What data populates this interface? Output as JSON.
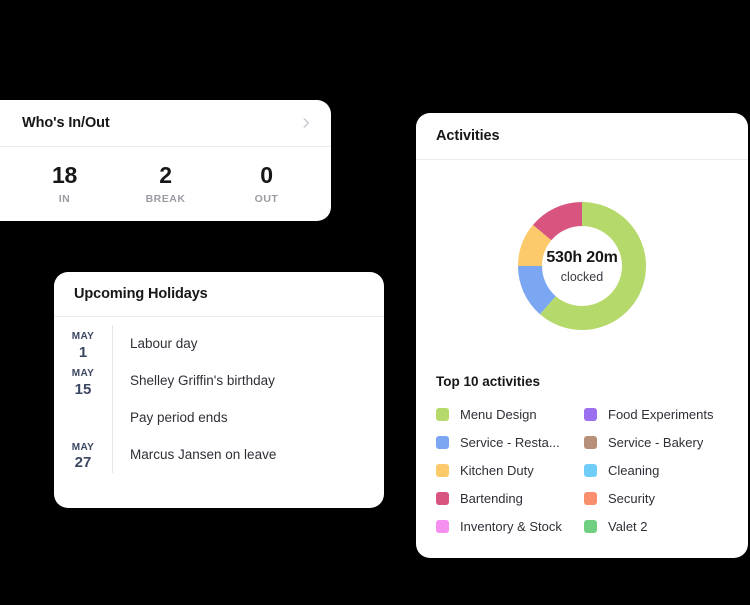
{
  "whos_in_out": {
    "title": "Who's In/Out",
    "chevron_icon": "chevron-right-icon",
    "stats": [
      {
        "value": "18",
        "label": "IN"
      },
      {
        "value": "2",
        "label": "BREAK"
      },
      {
        "value": "0",
        "label": "OUT"
      }
    ]
  },
  "upcoming_holidays": {
    "title": "Upcoming Holidays",
    "rows": [
      {
        "month": "MAY",
        "day": "1",
        "name": "Labour day"
      },
      {
        "month": "MAY",
        "day": "15",
        "name": "Shelley Griffin's birthday"
      },
      {
        "month": "",
        "day": "",
        "name": "Pay period ends"
      },
      {
        "month": "MAY",
        "day": "27",
        "name": "Marcus Jansen on leave"
      }
    ]
  },
  "activities": {
    "title": "Activities",
    "donut": {
      "total": "530h 20m",
      "subtitle": "clocked"
    },
    "legend_title": "Top 10 activities",
    "legend": [
      {
        "label": "Menu Design",
        "color": "#b5d96a"
      },
      {
        "label": "Food Experiments",
        "color": "#9b6ff0"
      },
      {
        "label": "Service - Resta...",
        "color": "#7ba6f2"
      },
      {
        "label": "Service - Bakery",
        "color": "#b8907a"
      },
      {
        "label": "Kitchen Duty",
        "color": "#fcc96b"
      },
      {
        "label": "Cleaning",
        "color": "#6fcdf7"
      },
      {
        "label": "Bartending",
        "color": "#d7557f"
      },
      {
        "label": "Security",
        "color": "#fa8f6e"
      },
      {
        "label": "Inventory & Stock",
        "color": "#f58ff0"
      },
      {
        "label": "Valet 2",
        "color": "#71cf82"
      }
    ]
  },
  "chart_data": {
    "type": "pie",
    "title": "Activities",
    "center_label": "530h 20m",
    "center_sublabel": "clocked",
    "donut": true,
    "start_angle_deg": 0,
    "direction": "clockwise",
    "total_hours": "530h 20m",
    "categories": [
      "Menu Design",
      "Service - Restaurant",
      "Kitchen Duty",
      "Bartending"
    ],
    "values": [
      61.4,
      13.6,
      11.1,
      13.9
    ],
    "unit": "percent",
    "segments": [
      {
        "label": "Menu Design",
        "color": "#b5d96a",
        "percent": 61.4,
        "start_deg": 0,
        "end_deg": 221
      },
      {
        "label": "Service - Restaurant",
        "color": "#7ba6f2",
        "percent": 13.6,
        "start_deg": 221,
        "end_deg": 270
      },
      {
        "label": "Kitchen Duty",
        "color": "#fcc96b",
        "percent": 11.1,
        "start_deg": 270,
        "end_deg": 310
      },
      {
        "label": "Bartending",
        "color": "#d7557f",
        "percent": 13.9,
        "start_deg": 310,
        "end_deg": 360
      }
    ],
    "legend_position": "below",
    "grid": false
  }
}
